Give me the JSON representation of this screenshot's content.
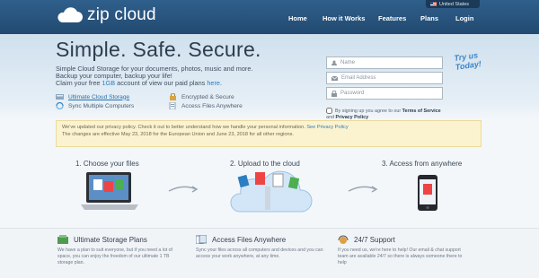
{
  "brand": {
    "name": "zip cloud"
  },
  "lang": {
    "label": "United States"
  },
  "nav": {
    "items": [
      {
        "label": "Home"
      },
      {
        "label": "How it Works"
      },
      {
        "label": "Features"
      },
      {
        "label": "Plans"
      },
      {
        "label": "Login"
      }
    ]
  },
  "hero": {
    "headline": "Simple. Safe. Secure.",
    "line1": "Simple Cloud Storage for your documents, photos, music and more.",
    "line2": "Backup your computer, backup your life!",
    "line3_prefix": "Claim your free ",
    "line3_link": "1GB",
    "line3_mid": " account of view our paid plans ",
    "line3_link2": "here",
    "line3_suffix": ".",
    "features": [
      {
        "label": "Ultimate Cloud Storage",
        "icon": "storage-icon"
      },
      {
        "label": "Encrypted & Secure",
        "icon": "lock-icon"
      },
      {
        "label": "Sync Multiple Computers",
        "icon": "sync-icon"
      },
      {
        "label": "Access Files Anywhere",
        "icon": "files-icon"
      }
    ]
  },
  "signup": {
    "name_placeholder": "Name",
    "email_placeholder": "Email Address",
    "password_placeholder": "Password",
    "consent_prefix": "By signing up you agree to our ",
    "terms": "Terms of Service",
    "and": " and ",
    "privacy": "Privacy Policy",
    "try_line1": "Try us",
    "try_line2": "Today!"
  },
  "notice": {
    "text1": "We've updated our privacy policy. Check it out to better understand how we handle your personal information.",
    "link": "See Privacy Policy",
    "text2": "The changes are effective May 23, 2018 for the European Union and June 23, 2018 for all other regions."
  },
  "steps": [
    {
      "label": "1. Choose your files"
    },
    {
      "label": "2. Upload to the cloud"
    },
    {
      "label": "3. Access from anywhere"
    }
  ],
  "bottom": [
    {
      "title": "Ultimate Storage Plans",
      "text": "We have a plan to suit everyone, but if you need a lot of space, you can enjoy the freedom of our ultimate 1 TB storage plan."
    },
    {
      "title": "Access Files Anywhere",
      "text": "Sync your files across all computers and devices and you can access your work anywhere, at any time."
    },
    {
      "title": "24/7 Support",
      "text": "If you need us, we're here to help! Our email & chat support team are available 24/7 so there is always someone there to help"
    }
  ],
  "colors": {
    "topbar": "#2f5f8c",
    "link": "#2b7ec1",
    "notice_bg": "#fbf3cf"
  }
}
